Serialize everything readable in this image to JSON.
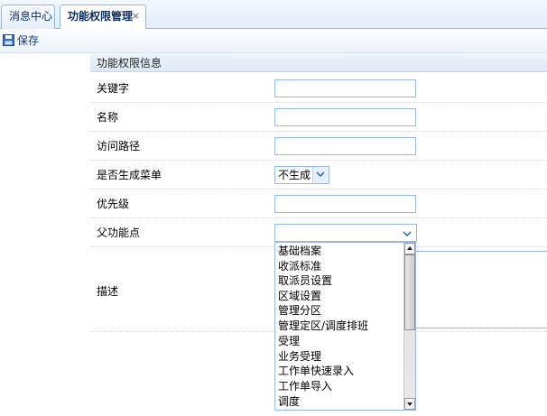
{
  "tabs": [
    {
      "label": "消息中心",
      "active": false
    },
    {
      "label": "功能权限管理",
      "active": true,
      "close_glyph": "×"
    }
  ],
  "toolbar": {
    "save_label": "保存",
    "save_icon": "save-icon"
  },
  "form": {
    "section_title": "功能权限信息",
    "fields": {
      "keyword": {
        "label": "关键字",
        "value": ""
      },
      "name": {
        "label": "名称",
        "value": ""
      },
      "path": {
        "label": "访问路径",
        "value": ""
      },
      "generate_menu": {
        "label": "是否生成菜单",
        "value": "不生成"
      },
      "priority": {
        "label": "优先级",
        "value": ""
      },
      "parent": {
        "label": "父功能点",
        "value": ""
      },
      "description": {
        "label": "描述",
        "value": ""
      }
    }
  },
  "parent_options": [
    "基础档案",
    "收派标准",
    "取派员设置",
    "区域设置",
    "管理分区",
    "管理定区/调度排班",
    "受理",
    "业务受理",
    "工作单快速录入",
    "工作单导入",
    "调度"
  ],
  "colors": {
    "border": "#95b8e7",
    "accent": "#0e3a86"
  }
}
